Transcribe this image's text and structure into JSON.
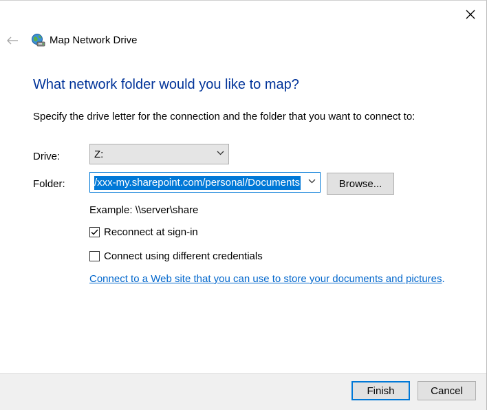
{
  "window": {
    "title": "Map Network Drive"
  },
  "icons": {
    "close": "close-icon",
    "back": "back-arrow-icon",
    "title": "network-drive-icon",
    "dropdown": "chevron-down-icon",
    "checkmark": "checkmark-icon"
  },
  "main": {
    "heading": "What network folder would you like to map?",
    "instruction": "Specify the drive letter for the connection and the folder that you want to connect to:",
    "drive_label": "Drive:",
    "drive_value": "Z:",
    "folder_label": "Folder:",
    "folder_value": "/xxx-my.sharepoint.com/personal/Documents",
    "browse_label": "Browse...",
    "example_text": "Example: \\\\server\\share",
    "reconnect_label": "Reconnect at sign-in",
    "reconnect_checked": true,
    "credentials_label": "Connect using different credentials",
    "credentials_checked": false,
    "web_link_text": "Connect to a Web site that you can use to store your documents and pictures",
    "web_link_suffix": "."
  },
  "footer": {
    "finish_label": "Finish",
    "cancel_label": "Cancel"
  },
  "colors": {
    "heading": "#003399",
    "link": "#0066cc",
    "selection": "#0078d7",
    "footer_bg": "#f0f0f0"
  }
}
